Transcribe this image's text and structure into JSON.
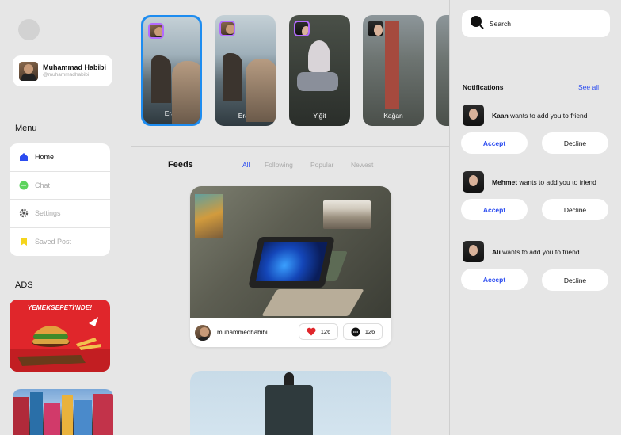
{
  "profile": {
    "name": "Muhammad Habibi",
    "handle": "@muhammadhabibi"
  },
  "menu": {
    "title": "Menu",
    "items": [
      {
        "label": "Home",
        "icon": "home-icon",
        "active": true
      },
      {
        "label": "Chat",
        "icon": "chat-icon",
        "active": false
      },
      {
        "label": "Settings",
        "icon": "gear-icon",
        "active": false
      },
      {
        "label": "Saved Post",
        "icon": "bookmark-icon",
        "active": false
      }
    ]
  },
  "ads": {
    "title": "ADS",
    "ad1_text": "YEMEKSEPETİ'NDE!"
  },
  "stories": [
    {
      "name": "Eray",
      "selected": true
    },
    {
      "name": "Eray",
      "selected": false
    },
    {
      "name": "Yiğit",
      "selected": false
    },
    {
      "name": "Kağan",
      "selected": false
    }
  ],
  "feeds": {
    "title": "Feeds",
    "tabs": [
      "All",
      "Following",
      "Popular",
      "Newest"
    ],
    "active_tab": "All"
  },
  "post": {
    "username": "muhammedhabibi",
    "likes": "126",
    "comments": "126"
  },
  "search": {
    "placeholder": "Search"
  },
  "notifications": {
    "title": "Notifications",
    "see_all": "See all",
    "items": [
      {
        "name": "Kaan",
        "text": " wants to add you to friend",
        "accept": "Accept",
        "decline": "Decline"
      },
      {
        "name": "Mehmet",
        "text": " wants to add you to friend",
        "accept": "Accept",
        "decline": "Decline"
      },
      {
        "name": "Ali",
        "text": " wants to add you to friend",
        "accept": "Accept",
        "decline": "Decline"
      }
    ]
  },
  "colors": {
    "accent": "#2b4cf0",
    "story_border": "#1d8cf0",
    "heart": "#e0262b"
  }
}
